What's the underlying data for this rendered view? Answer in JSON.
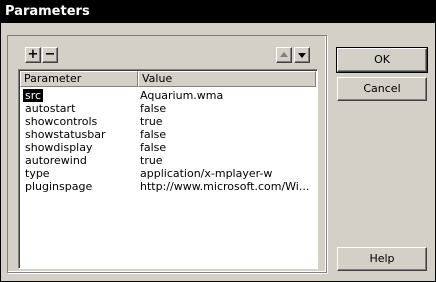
{
  "window": {
    "title": "Parameters"
  },
  "toolbar": {
    "add_label": "+",
    "remove_label": "−",
    "up_icon": "triangle-up",
    "down_icon": "triangle-down"
  },
  "table": {
    "columns": [
      "Parameter",
      "Value"
    ],
    "rows": [
      {
        "param": "src",
        "value": "Aquarium.wma",
        "selected": true
      },
      {
        "param": "autostart",
        "value": "false"
      },
      {
        "param": "showcontrols",
        "value": "true"
      },
      {
        "param": "showstatusbar",
        "value": "false"
      },
      {
        "param": "showdisplay",
        "value": "false"
      },
      {
        "param": "autorewind",
        "value": "true"
      },
      {
        "param": "type",
        "value": "application/x-mplayer-w"
      },
      {
        "param": "pluginspage",
        "value": "http://www.microsoft.com/Wi..."
      }
    ]
  },
  "buttons": {
    "ok": "OK",
    "cancel": "Cancel",
    "help": "Help"
  }
}
